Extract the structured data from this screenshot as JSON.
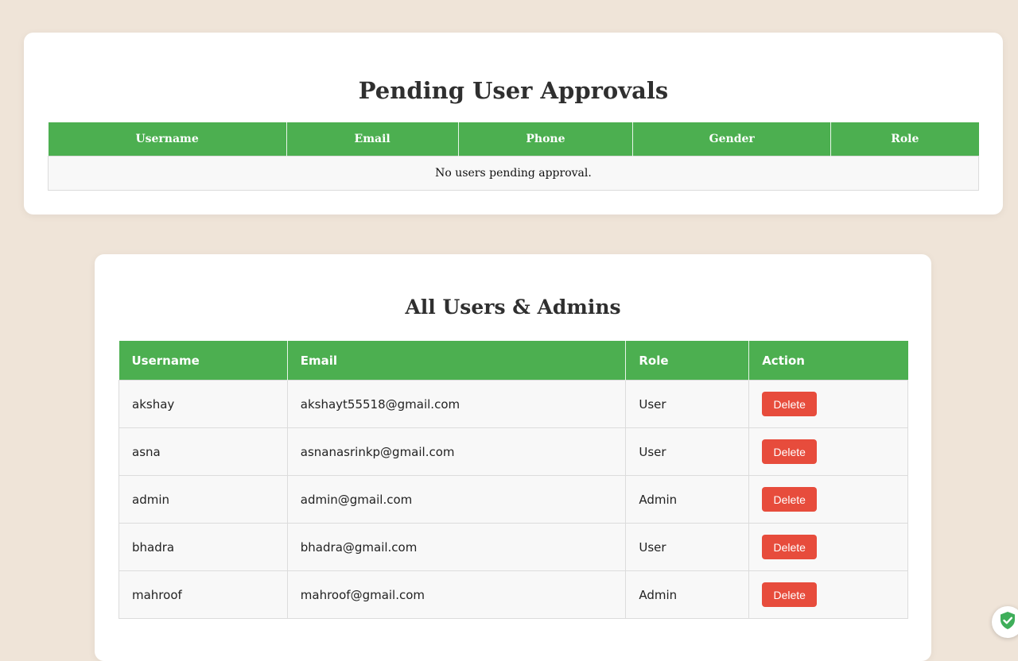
{
  "pending": {
    "title": "Pending User Approvals",
    "headers": [
      "Username",
      "Email",
      "Phone",
      "Gender",
      "Role"
    ],
    "empty_message": "No users pending approval."
  },
  "users": {
    "title": "All Users & Admins",
    "headers": [
      "Username",
      "Email",
      "Role",
      "Action"
    ],
    "rows": [
      {
        "username": "akshay",
        "email": "akshayt55518@gmail.com",
        "role": "User",
        "action": "Delete"
      },
      {
        "username": "asna",
        "email": "asnanasrinkp@gmail.com",
        "role": "User",
        "action": "Delete"
      },
      {
        "username": "admin",
        "email": "admin@gmail.com",
        "role": "Admin",
        "action": "Delete"
      },
      {
        "username": "bhadra",
        "email": "bhadra@gmail.com",
        "role": "User",
        "action": "Delete"
      },
      {
        "username": "mahroof",
        "email": "mahroof@gmail.com",
        "role": "Admin",
        "action": "Delete"
      }
    ]
  },
  "colors": {
    "background": "#efe4d8",
    "header_green": "#4caf50",
    "delete_red": "#e74c3c"
  },
  "icons": {
    "badge": "shield-check-icon"
  }
}
